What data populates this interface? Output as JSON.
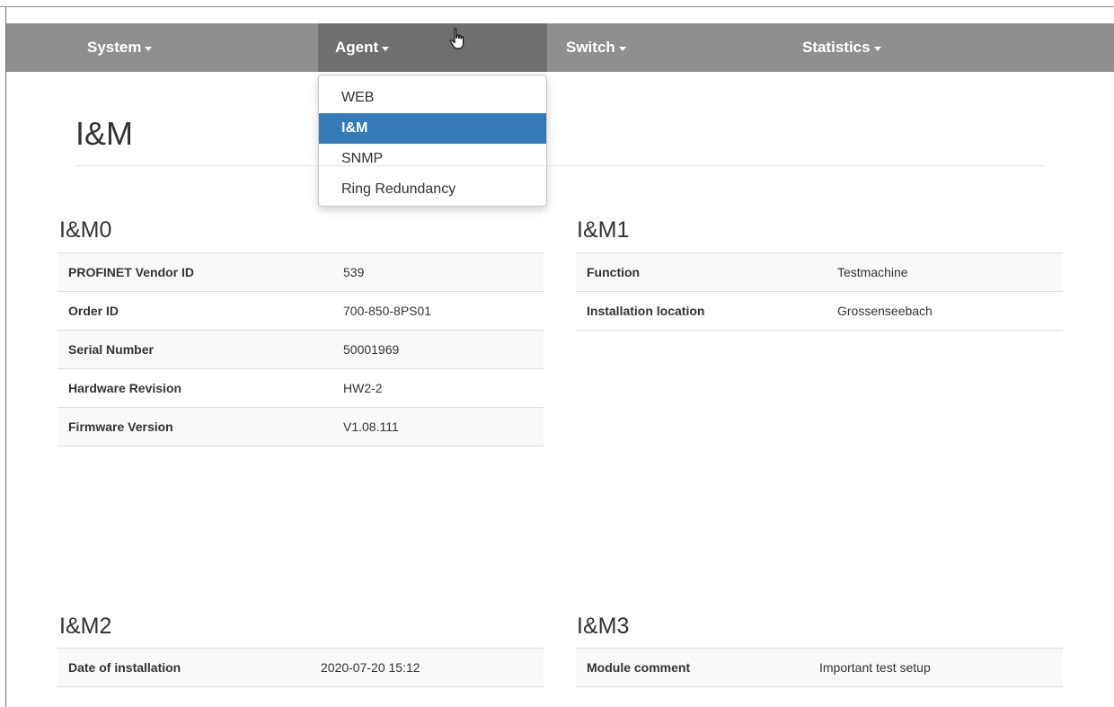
{
  "nav": {
    "items": [
      {
        "label": "System"
      },
      {
        "label": "Agent"
      },
      {
        "label": "Switch"
      },
      {
        "label": "Statistics"
      }
    ]
  },
  "agent_menu": {
    "items": [
      {
        "label": "WEB"
      },
      {
        "label": "I&M"
      },
      {
        "label": "SNMP"
      },
      {
        "label": "Ring Redundancy"
      }
    ],
    "selected": "I&M"
  },
  "page": {
    "title": "I&M"
  },
  "im0": {
    "title": "I&M0",
    "rows": [
      {
        "key": "PROFINET Vendor ID",
        "value": "539"
      },
      {
        "key": "Order ID",
        "value": "700-850-8PS01"
      },
      {
        "key": "Serial Number",
        "value": "50001969"
      },
      {
        "key": "Hardware Revision",
        "value": "HW2-2"
      },
      {
        "key": "Firmware Version",
        "value": "V1.08.111"
      }
    ]
  },
  "im1": {
    "title": "I&M1",
    "rows": [
      {
        "key": "Function",
        "value": "Testmachine"
      },
      {
        "key": "Installation location",
        "value": "Grossenseebach"
      }
    ]
  },
  "im2": {
    "title": "I&M2",
    "rows": [
      {
        "key": "Date of installation",
        "value": "2020-07-20 15:12"
      }
    ]
  },
  "im3": {
    "title": "I&M3",
    "rows": [
      {
        "key": "Module comment",
        "value": "Important test setup"
      }
    ]
  },
  "colors": {
    "navbar": "#8f8f8f",
    "navbar_active": "#6f6f6f",
    "menu_selected": "#337ab7"
  },
  "icons": {
    "cursor": "hand-pointer-icon",
    "caret": "caret-down-icon"
  }
}
